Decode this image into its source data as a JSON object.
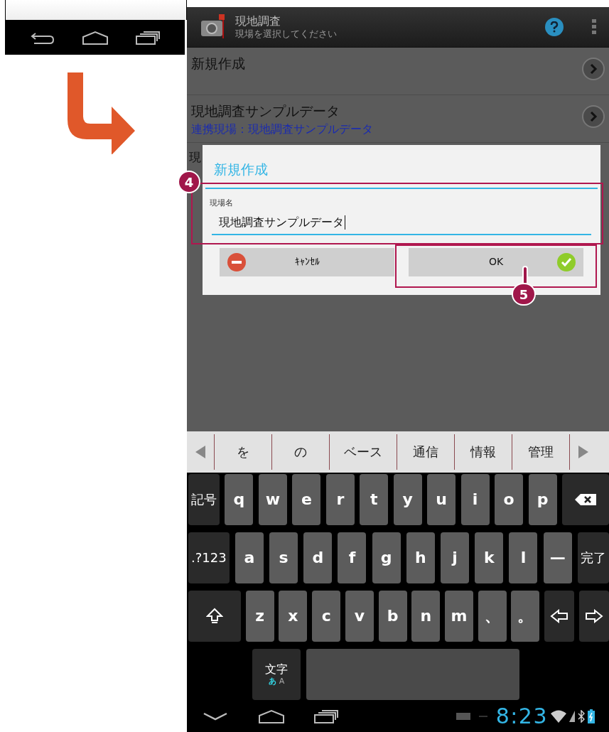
{
  "phone": {
    "action_bar": {
      "title": "現地調査",
      "subtitle": "現場を選択してください"
    },
    "list": [
      {
        "title": "新規作成"
      },
      {
        "title": "現地調査サンプルデータ",
        "subtitle": "連携現場：現地調査サンプルデータ"
      }
    ],
    "covered_row": {
      "title": "現"
    },
    "dialog": {
      "title": "新規作成",
      "field_label": "現場名",
      "value": "現地調査サンプルデータ",
      "buttons": [
        {
          "kind": "cancel",
          "label": "ｷｬﾝｾﾙ"
        },
        {
          "kind": "ok",
          "label": "OK"
        }
      ]
    },
    "suggestions": [
      "を",
      "の",
      "ベース",
      "通信",
      "情報",
      "管理"
    ],
    "keyboard": [
      [
        {
          "kind": "function",
          "label": "記号"
        },
        {
          "kind": "letter",
          "label": "q"
        },
        {
          "kind": "letter",
          "label": "w"
        },
        {
          "kind": "letter",
          "label": "e"
        },
        {
          "kind": "letter",
          "label": "r"
        },
        {
          "kind": "letter",
          "label": "t"
        },
        {
          "kind": "letter",
          "label": "y"
        },
        {
          "kind": "letter",
          "label": "u"
        },
        {
          "kind": "letter",
          "label": "i"
        },
        {
          "kind": "letter",
          "label": "o"
        },
        {
          "kind": "letter",
          "label": "p"
        },
        {
          "kind": "backspace"
        }
      ],
      [
        {
          "kind": "function",
          "label": ".?123"
        },
        {
          "kind": "letter",
          "label": "a"
        },
        {
          "kind": "letter",
          "label": "s"
        },
        {
          "kind": "letter",
          "label": "d"
        },
        {
          "kind": "letter",
          "label": "f"
        },
        {
          "kind": "letter",
          "label": "g"
        },
        {
          "kind": "letter",
          "label": "h"
        },
        {
          "kind": "letter",
          "label": "j"
        },
        {
          "kind": "letter",
          "label": "k"
        },
        {
          "kind": "letter",
          "label": "l"
        },
        {
          "kind": "letter",
          "label": "—"
        },
        {
          "kind": "function",
          "label": "完了"
        }
      ],
      [
        {
          "kind": "shift"
        },
        {
          "kind": "letter",
          "label": "z"
        },
        {
          "kind": "letter",
          "label": "x"
        },
        {
          "kind": "letter",
          "label": "c"
        },
        {
          "kind": "letter",
          "label": "v"
        },
        {
          "kind": "letter",
          "label": "b"
        },
        {
          "kind": "letter",
          "label": "n"
        },
        {
          "kind": "letter",
          "label": "m"
        },
        {
          "kind": "letter",
          "label": "、"
        },
        {
          "kind": "letter",
          "label": "。"
        },
        {
          "kind": "left"
        },
        {
          "kind": "right"
        }
      ],
      [
        {
          "kind": "mode",
          "label": "文字",
          "sublabel_1": "あ",
          "sublabel_2": "A"
        },
        {
          "kind": "space"
        }
      ]
    ],
    "status_bar": {
      "time": "8:23"
    }
  },
  "callouts": [
    {
      "label": "4"
    },
    {
      "label": "5"
    }
  ]
}
